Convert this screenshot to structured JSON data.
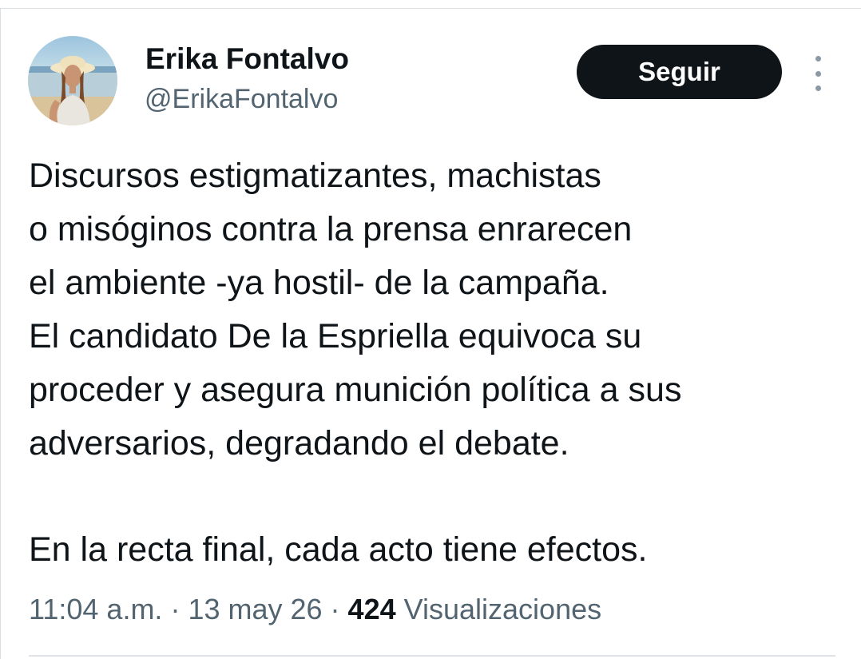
{
  "author": {
    "name": "Erika Fontalvo",
    "handle": "@ErikaFontalvo"
  },
  "follow_button": {
    "label": "Seguir"
  },
  "more_menu": {
    "icon": "more-vertical-icon"
  },
  "tweet": {
    "lines": [
      "Discursos estigmatizantes, machistas",
      "o misóginos contra la prensa enrarecen",
      "el ambiente -ya hostil- de la campaña.",
      "El candidato De la Espriella equivoca su",
      "proceder y asegura munición política a sus",
      "adversarios, degradando el debate."
    ],
    "closing_line": "En la recta final, cada acto tiene efectos."
  },
  "meta": {
    "time": "11:04 a.m.",
    "separator": " · ",
    "date": "13 may 26",
    "views_count": "424",
    "views_label": " Visualizaciones"
  },
  "colors": {
    "text_primary": "#0f1419",
    "text_secondary": "#536471",
    "button_bg": "#0f1419",
    "button_text": "#ffffff"
  }
}
